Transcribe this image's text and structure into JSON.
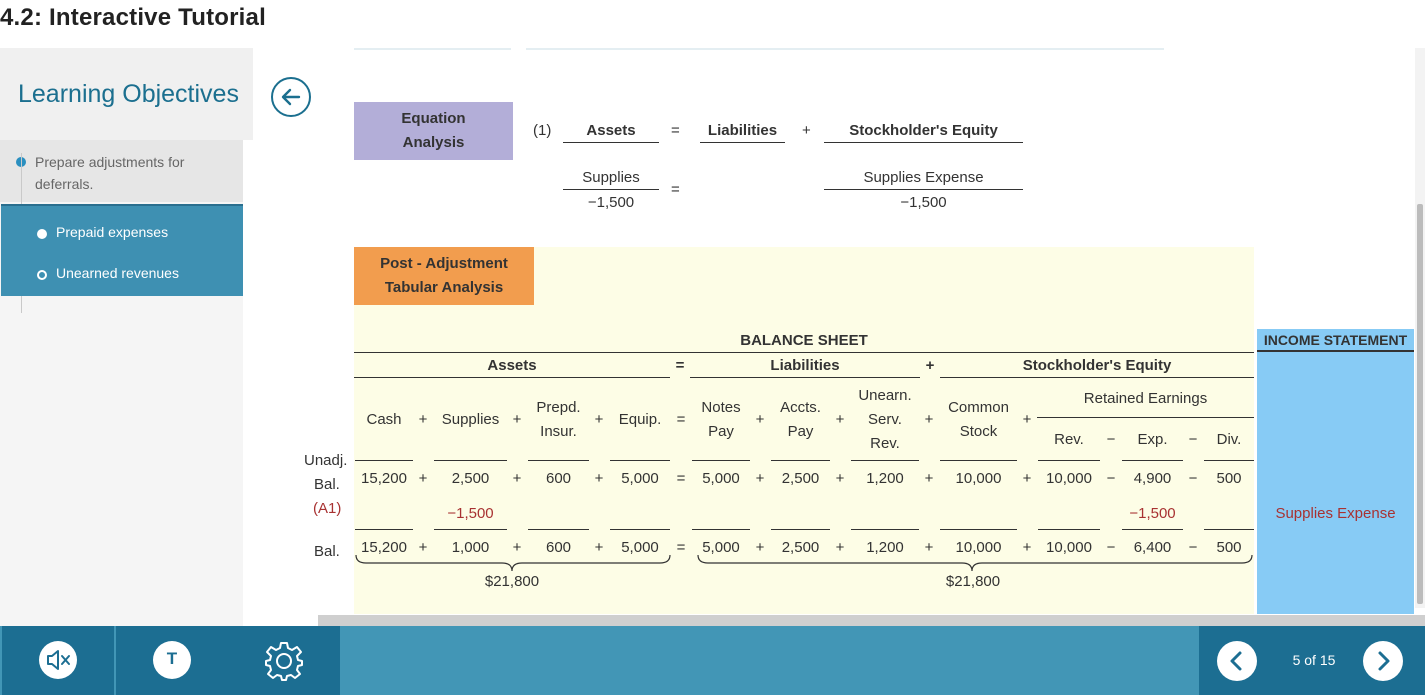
{
  "page_title": "4.2: Interactive Tutorial",
  "sidebar": {
    "title": "Learning Objectives",
    "objective": "Prepare adjustments for deferrals.",
    "sub_items": [
      "Prepaid expenses",
      "Unearned revenues"
    ]
  },
  "equation": {
    "header": [
      "Equation",
      "Analysis"
    ],
    "step": "(1)",
    "assets": "Assets",
    "equals": "=",
    "liabilities": "Liabilities",
    "plus": "+",
    "equity": "Stockholder's Equity",
    "left_account": "Supplies",
    "left_value": "−1,500",
    "right_account": "Supplies Expense",
    "right_value": "−1,500"
  },
  "tabular": {
    "header": [
      "Post - Adjustment",
      "Tabular Analysis"
    ],
    "balance_sheet": "BALANCE SHEET",
    "income_statement": "INCOME STATEMENT",
    "groups": {
      "assets": "Assets",
      "liabilities": "Liabilities",
      "equity": "Stockholder's Equity",
      "retained": "Retained Earnings"
    },
    "columns": {
      "cash": "Cash",
      "supplies": "Supplies",
      "prepd1": "Prepd.",
      "prepd2": "Insur.",
      "equip": "Equip.",
      "notes1": "Notes",
      "notes2": "Pay",
      "accts1": "Accts.",
      "accts2": "Pay",
      "unearn1": "Unearn.",
      "unearn2": "Serv.",
      "unearn3": "Rev.",
      "common1": "Common",
      "common2": "Stock",
      "rev": "Rev.",
      "exp": "Exp.",
      "div": "Div."
    },
    "row_labels": {
      "unadj1": "Unadj.",
      "unadj2": "Bal.",
      "a1": "(A1)",
      "bal": "Bal."
    },
    "unadj": [
      "15,200",
      "2,500",
      "600",
      "5,000",
      "5,000",
      "2,500",
      "1,200",
      "10,000",
      "10,000",
      "4,900",
      "500"
    ],
    "a1": {
      "supplies": "−1,500",
      "exp": "−1,500",
      "income": "Supplies Expense"
    },
    "bal": [
      "15,200",
      "1,000",
      "600",
      "5,000",
      "5,000",
      "2,500",
      "1,200",
      "10,000",
      "10,000",
      "6,400",
      "500"
    ],
    "total_assets": "$21,800",
    "total_le": "$21,800",
    "ops": {
      "plus": "+",
      "minus": "−",
      "equals": "="
    }
  },
  "footer": {
    "text_icon": "T",
    "page_counter": "5 of 15"
  }
}
